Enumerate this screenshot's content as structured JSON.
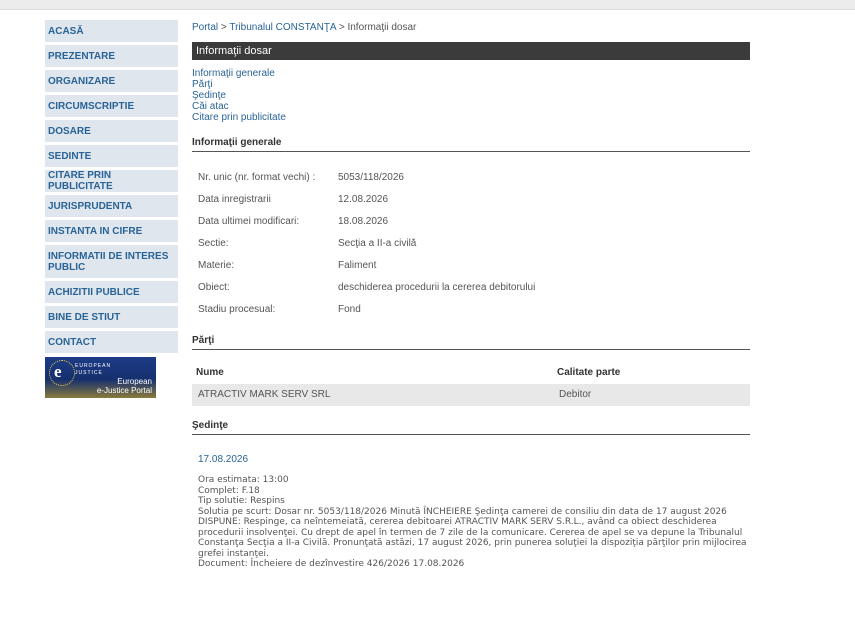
{
  "sidebar": {
    "items": [
      {
        "label": "ACASĂ"
      },
      {
        "label": "PREZENTARE"
      },
      {
        "label": "ORGANIZARE"
      },
      {
        "label": "CIRCUMSCRIPTIE"
      },
      {
        "label": "DOSARE"
      },
      {
        "label": "SEDINTE"
      },
      {
        "label": "CITARE PRIN PUBLICITATE"
      },
      {
        "label": "JURISPRUDENTA"
      },
      {
        "label": "INSTANTA IN CIFRE"
      },
      {
        "label": "INFORMATII DE INTERES PUBLIC"
      },
      {
        "label": "ACHIZITII PUBLICE"
      },
      {
        "label": "BINE DE STIUT"
      },
      {
        "label": "CONTACT"
      }
    ],
    "banner": {
      "line1": "EUROPEAN",
      "line2": "JUSTICE",
      "line3": "European",
      "line4": "e-Justice Portal"
    }
  },
  "breadcrumb": {
    "portal": "Portal",
    "court": "Tribunalul CONSTANŢA",
    "current": "Informaţii dosar",
    "sep": ">"
  },
  "page_title": "Informaţii dosar",
  "anchors": [
    "Informaţii generale",
    "Părţi",
    "Şedinţe",
    "Căi atac",
    "Citare prin publicitate"
  ],
  "general": {
    "heading": "Informaţii generale",
    "rows": [
      {
        "label": "Nr. unic (nr. format vechi) :",
        "value": "5053/118/2026"
      },
      {
        "label": "Data inregistrarii",
        "value": "12.08.2026"
      },
      {
        "label": "Data ultimei modificari:",
        "value": "18.08.2026"
      },
      {
        "label": "Sectie:",
        "value": "Secţia a II-a civilă"
      },
      {
        "label": "Materie:",
        "value": "Faliment"
      },
      {
        "label": "Obiect:",
        "value": "deschiderea procedurii la cererea debitorului"
      },
      {
        "label": "Stadiu procesual:",
        "value": "Fond"
      }
    ]
  },
  "parti": {
    "heading": "Părţi",
    "col_name": "Nume",
    "col_role": "Calitate parte",
    "rows": [
      {
        "name": "ATRACTIV MARK SERV SRL",
        "role": "Debitor"
      }
    ]
  },
  "sedinte": {
    "heading": "Şedinţe",
    "date": "17.08.2026",
    "lines": [
      "Ora estimata: 13:00",
      "Complet: F.18",
      "Tip solutie: Respins",
      "Solutia pe scurt: Dosar nr. 5053/118/2026 Minută ÎNCHEIERE Şedinţa camerei de consiliu din data de 17 august 2026",
      "DISPUNE: Respinge, ca neîntemeiată, cererea debitoarei ATRACTIV MARK SERV S.R.L., având ca obiect deschiderea procedurii insolvenţei. Cu drept de apel în termen de 7 zile de la comunicare. Cererea de apel se va depune la Tribunalul Constanţa Secţia a II-a Civilă. Pronunţată astăzi, 17 august 2026, prin punerea soluţiei la dispoziţia părţilor prin mijlocirea grefei instanţei.",
      "Document: Încheiere de dezînvestire  426/2026  17.08.2026"
    ]
  }
}
